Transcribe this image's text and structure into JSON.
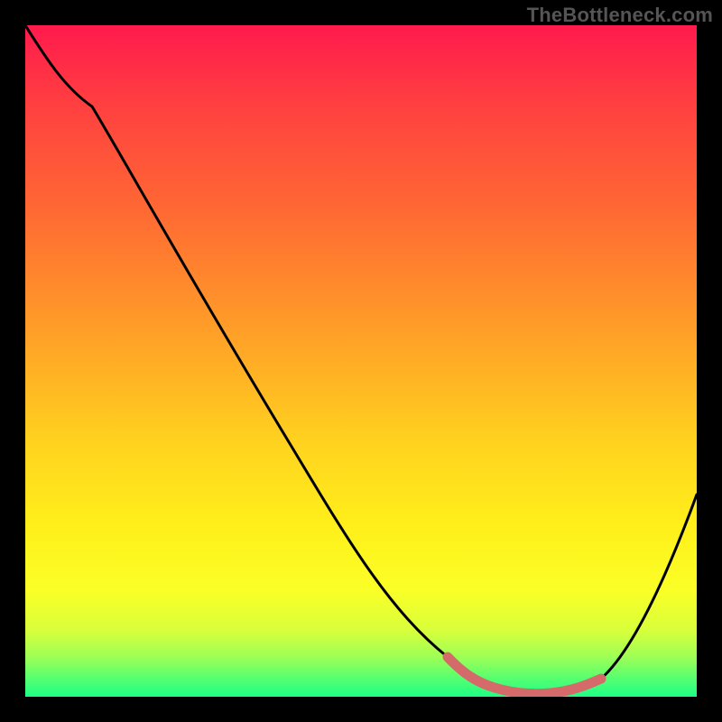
{
  "watermark": "TheBottleneck.com",
  "chart_data": {
    "type": "line",
    "title": "",
    "xlabel": "",
    "ylabel": "",
    "xlim": [
      0,
      1
    ],
    "ylim": [
      0,
      1
    ],
    "grid": false,
    "legend": false,
    "series": [
      {
        "name": "bottleneck-curve",
        "x": [
          0.0,
          0.05,
          0.1,
          0.2,
          0.3,
          0.4,
          0.5,
          0.57,
          0.63,
          0.7,
          0.78,
          0.85,
          0.9,
          0.95,
          1.0
        ],
        "y": [
          1.0,
          0.95,
          0.88,
          0.73,
          0.58,
          0.44,
          0.29,
          0.17,
          0.07,
          0.015,
          0.005,
          0.01,
          0.07,
          0.17,
          0.3
        ],
        "note": "y = 0 is the green bottom (no bottleneck); y = 1 is the red top."
      }
    ],
    "highlight": {
      "name": "valley-marker",
      "x": [
        0.63,
        0.66,
        0.7,
        0.74,
        0.78,
        0.82,
        0.85
      ],
      "y": [
        0.07,
        0.035,
        0.015,
        0.008,
        0.005,
        0.007,
        0.01
      ],
      "color": "#d46a6a"
    },
    "colors": {
      "background_top": "#ff1a4d",
      "background_bottom": "#1cff85",
      "curve": "#000000",
      "highlight": "#d46a6a",
      "frame": "#000000"
    }
  }
}
